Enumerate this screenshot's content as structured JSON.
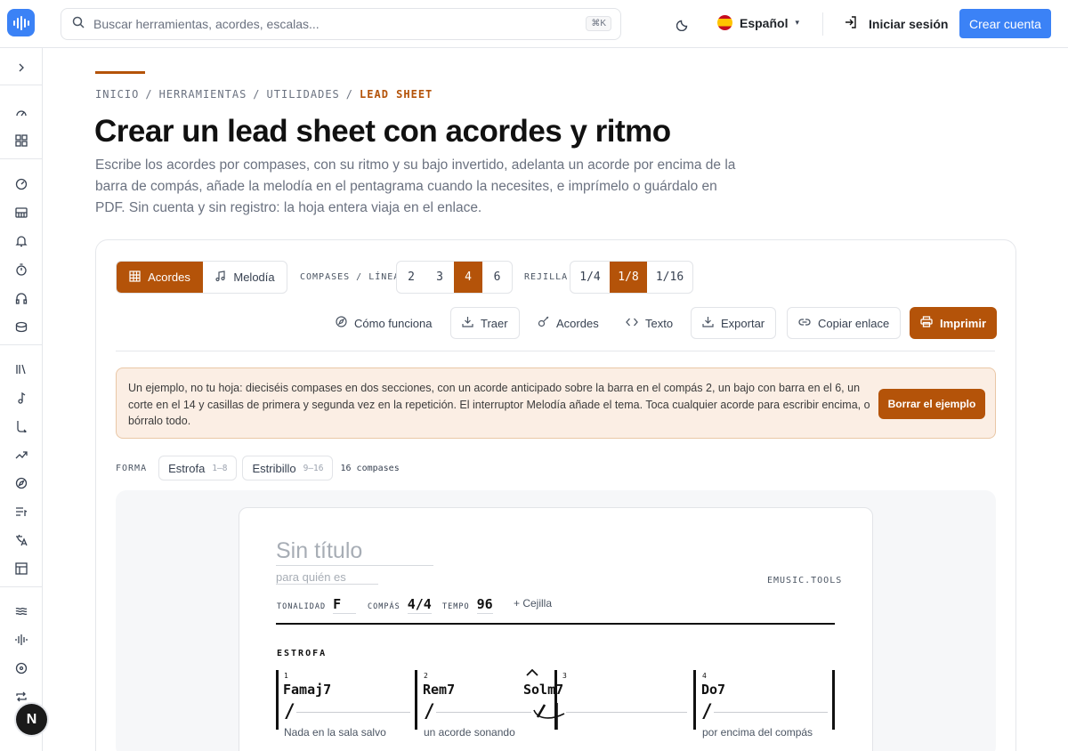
{
  "colors": {
    "accent": "#b45309",
    "primary": "#3b82f6",
    "notice_bg": "#fbeee4"
  },
  "header": {
    "logo_icon": "waveform-icon",
    "search_placeholder": "Buscar herramientas, acordes, escalas...",
    "search_shortcut": "⌘K",
    "language": "Español",
    "login": "Iniciar sesión",
    "signup": "Crear cuenta"
  },
  "sidebar": {
    "expand_icon": "chevron-right-icon",
    "icons": [
      "gauge-icon",
      "grid-icon",
      "tuner-icon",
      "piano-icon",
      "bell-icon",
      "stopwatch-icon",
      "headphones-icon",
      "drum-icon",
      "library-icon",
      "music-note-icon",
      "branch-icon",
      "trend-icon",
      "compass-icon",
      "list-music-icon",
      "translate-icon",
      "table-icon",
      "waves-icon",
      "audio-wave-icon",
      "disc-icon",
      "repeat-icon"
    ],
    "avatar": "N"
  },
  "breadcrumb": [
    "INICIO",
    "HERRAMIENTAS",
    "UTILIDADES",
    "LEAD SHEET"
  ],
  "page": {
    "title": "Crear un lead sheet con acordes y ritmo",
    "lede": "Escribe los acordes por compases, con su ritmo y su bajo invertido, adelanta un acorde por encima de la barra de compás, añade la melodía en el pentagrama cuando la necesites, e imprímelo o guárdalo en PDF. Sin cuenta y sin registro: la hoja entera viaja en el enlace."
  },
  "editor": {
    "modes": [
      {
        "label": "Acordes",
        "active": true
      },
      {
        "label": "Melodía",
        "active": false
      }
    ],
    "bars_label": "COMPASES / LÍNEA",
    "bars_options": [
      "2",
      "3",
      "4",
      "6"
    ],
    "bars_selected": "4",
    "grid_label": "REJILLA",
    "grid_options": [
      "1/4",
      "1/8",
      "1/16"
    ],
    "grid_selected": "1/8",
    "tools": {
      "how": "Cómo funciona",
      "import": "Traer",
      "chords": "Acordes",
      "text": "Texto",
      "export": "Exportar",
      "copy_link": "Copiar enlace",
      "print": "Imprimir"
    },
    "notice": {
      "text": "Un ejemplo, no tu hoja: dieciséis compases en dos secciones, con un acorde anticipado sobre la barra en el compás 2, un bajo con barra en el 6, un corte en el 14 y casillas de primera y segunda vez en la repetición. El interruptor Melodía añade el tema. Toca cualquier acorde para escribir encima, o bórralo todo.",
      "button": "Borrar el ejemplo"
    },
    "form": {
      "label": "FORMA",
      "sections": [
        {
          "name": "Estrofa",
          "range": "1–8"
        },
        {
          "name": "Estribillo",
          "range": "9–16"
        }
      ],
      "total": "16 compases"
    }
  },
  "sheet": {
    "title_placeholder": "Sin título",
    "for_placeholder": "para quién es",
    "brand": "EMUSIC.TOOLS",
    "key_label": "TONALIDAD",
    "key": "F",
    "time_label": "COMPÁS",
    "time": "4/4",
    "tempo_label": "TEMPO",
    "tempo": "96",
    "capo": "+ Cejilla",
    "section": "ESTROFA",
    "measures": [
      {
        "num": "1",
        "chord": "Famaj7",
        "lyric": "Nada en la sala salvo"
      },
      {
        "num": "2",
        "chord": "Rem7",
        "lyric": "un acorde sonando",
        "push_chord": "Solm7"
      },
      {
        "num": "3",
        "chord": "",
        "lyric": ""
      },
      {
        "num": "4",
        "chord": "Do7",
        "lyric": "por encima del compás"
      }
    ]
  }
}
